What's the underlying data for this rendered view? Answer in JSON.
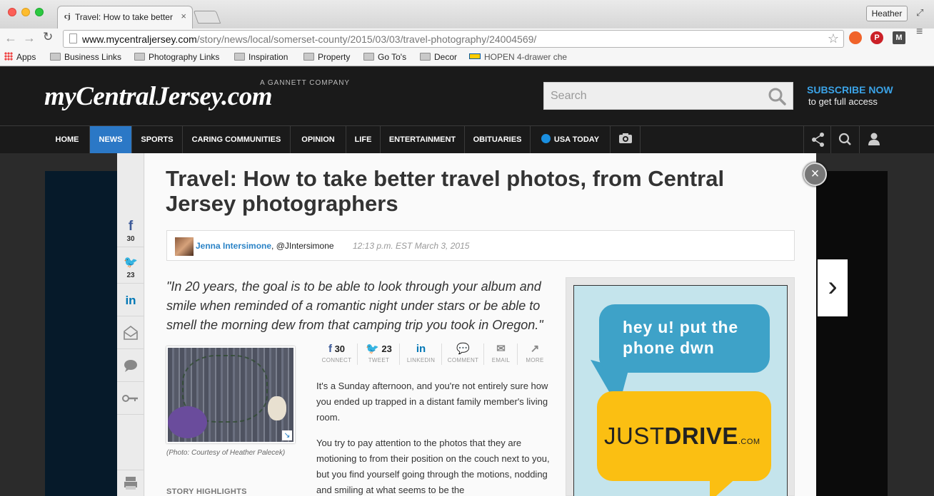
{
  "browser": {
    "tab_title": "Travel: How to take better",
    "tab_favicon": "cj",
    "close_glyph": "×",
    "user_name": "Heather",
    "url_host": "www.mycentraljersey.com",
    "url_path": "/story/news/local/somerset-county/2015/03/03/travel-photography/24004569/",
    "bookmarks": [
      "Apps",
      "Business Links",
      "Photography Links",
      "Inspiration",
      "Property",
      "Go To's",
      "Decor",
      "HOPEN 4-drawer che"
    ],
    "extensions": [
      "fire-extension-icon",
      "pinterest-icon",
      "m-extension-icon"
    ],
    "ext_m_label": "M"
  },
  "site": {
    "logo": "myCentralJersey.com",
    "logo_tagline": "A GANNETT COMPANY",
    "search_placeholder": "Search",
    "subscribe_title": "SUBSCRIBE NOW",
    "subscribe_sub": "to get full access",
    "nav": [
      "HOME",
      "NEWS",
      "SPORTS",
      "CARING COMMUNITIES",
      "OPINION",
      "LIFE",
      "ENTERTAINMENT",
      "OBITUARIES",
      "USA TODAY"
    ],
    "active_nav": "NEWS",
    "accent_color": "#2b78c6"
  },
  "rail": {
    "facebook_icon": "f",
    "twitter_icon": "🐦",
    "linkedin_icon": "in",
    "facebook_count": "30",
    "twitter_count": "23"
  },
  "article": {
    "headline": "Travel: How to take better travel photos, from Central Jersey photographers",
    "author": "Jenna Intersimone",
    "handle": ", @JIntersimone",
    "date": "12:13 p.m. EST March 3, 2015",
    "pullquote": "\"In 20 years, the goal is to be able to look through your album and smile when reminded of a romantic night under stars or be able to smell the morning dew from that camping trip you took in Oregon.\"",
    "photo_caption": "(Photo: Courtesy of Heather Palecek)",
    "highlights_label": "STORY HIGHLIGHTS",
    "share": [
      {
        "icon": "f",
        "count": "30",
        "label": "CONNECT"
      },
      {
        "icon": "🐦",
        "count": "23",
        "label": "TWEET"
      },
      {
        "icon": "in",
        "count": "",
        "label": "LINKEDIN"
      },
      {
        "icon": "💬",
        "count": "",
        "label": "COMMENT"
      },
      {
        "icon": "✉",
        "count": "",
        "label": "EMAIL"
      },
      {
        "icon": "↗",
        "count": "",
        "label": "MORE"
      }
    ],
    "paragraphs": [
      "It's a Sunday afternoon, and you're not entirely sure how you ended up trapped in a distant family member's living room.",
      "You try to pay attention to the photos that they are motioning to from their position on the couch next to you, but you find yourself going through the motions, nodding and smiling at what seems to be the"
    ]
  },
  "ad": {
    "line1": "hey u! put the phone dwn",
    "brand_a": "JUST",
    "brand_b": "DRIVE",
    "brand_c": ".COM"
  }
}
